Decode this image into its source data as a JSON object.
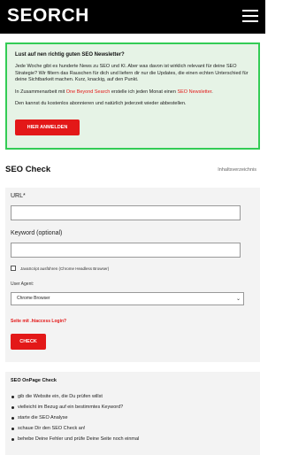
{
  "header": {
    "logo": "SEORCH",
    "menu_icon": "hamburger-menu-icon"
  },
  "newsletter": {
    "title": "Lust auf nen richtig guten SEO Newsletter?",
    "paragraph1": "Jede Woche gibt es hunderte News zu SEO und KI. Aber was davon ist wirklich relevant für deine SEO Strategie? Wir filtern das Rauschen für dich und liefern dir nur die Updates, die einen echten Unterschied für deine Sichtbarkeit machen. Kurz, knackig, auf den Punkt.",
    "p2_before": "In Zusammenarbeit mit ",
    "p2_link1": "One Beyond Search",
    "p2_middle": " erstelle ich jeden Monat einen ",
    "p2_link2": "SEO Newsletter",
    "p2_after": ".",
    "paragraph3": "Den kannst du kostenlos abonnieren und natürlich jederzeit wieder abbestellen.",
    "button_label": "HIER ANMELDEN",
    "border_color": "#33cc55",
    "accent_color": "#e31818"
  },
  "seo_check": {
    "heading": "SEO Check",
    "toc_label": "Inhaltsverzeichnis",
    "url_label": "URL*",
    "url_value": "",
    "keyword_label": "Keyword (optional)",
    "keyword_value": "",
    "javascript_label": "JavaScript ausführen (Chrome Headless Browser)",
    "javascript_checked": false,
    "user_agent_label": "User Agent:",
    "user_agent_selected": "Chrome Browser",
    "warning": "Seite mit .htaccess Login?",
    "check_button": "CHECK"
  },
  "onpage": {
    "title": "SEO OnPage Check",
    "items": [
      "gib die Website ein, die Du prüfen willst",
      "vielleicht im Bezug auf ein bestimmtes Keyword?",
      "starte die SEO Analyse",
      "schaue Dir den SEO Check an!",
      "behebe Deine Fehler und prüfe Deine Seite noch einmal"
    ]
  }
}
